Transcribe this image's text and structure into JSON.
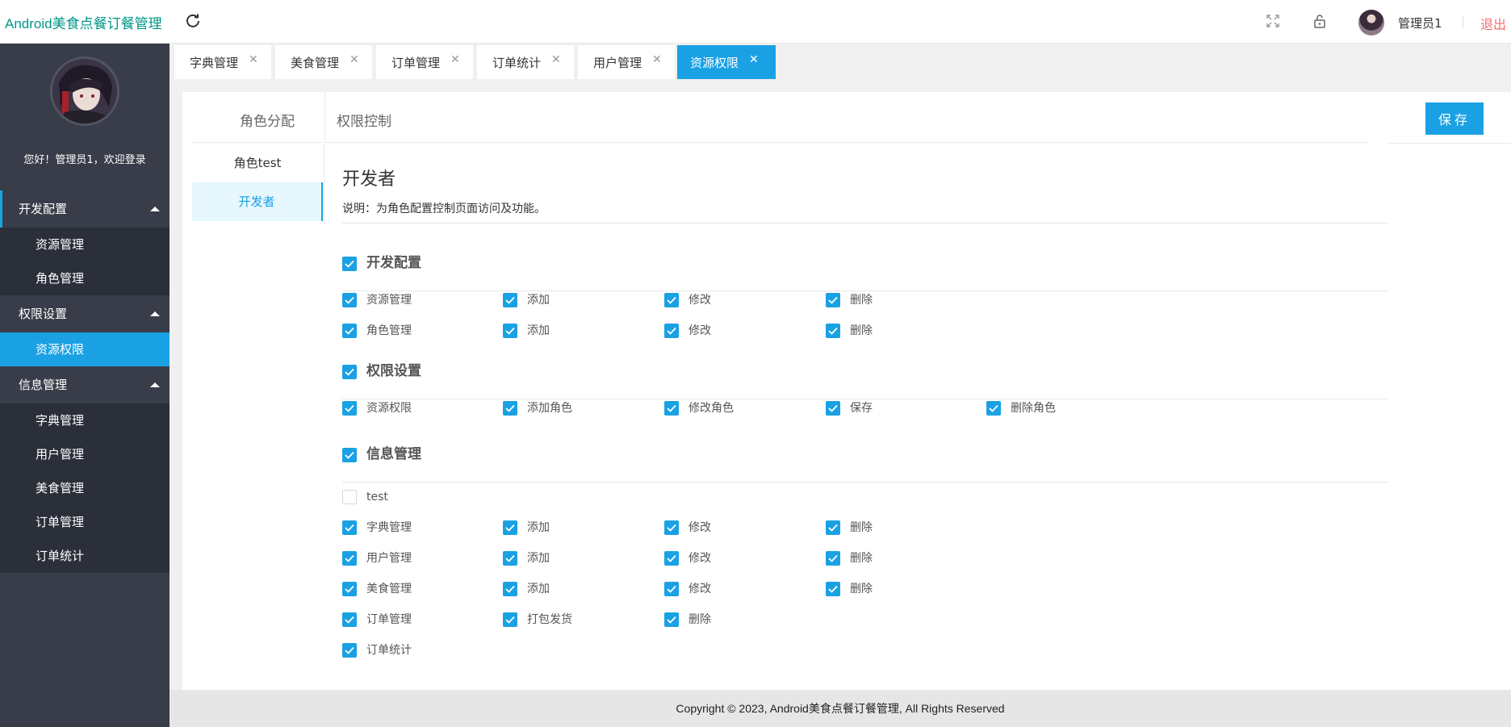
{
  "header": {
    "app_title": "Android美食点餐订餐管理",
    "user_name": "管理员1",
    "logout": "退出"
  },
  "sidebar": {
    "welcome": "您好！管理员1，欢迎登录",
    "groups": [
      {
        "label": "开发配置",
        "items": [
          "资源管理",
          "角色管理"
        ]
      },
      {
        "label": "权限设置",
        "items": [
          "资源权限"
        ]
      },
      {
        "label": "信息管理",
        "items": [
          "字典管理",
          "用户管理",
          "美食管理",
          "订单管理",
          "订单统计"
        ]
      }
    ]
  },
  "tabs": [
    {
      "label": "字典管理",
      "close": "✕"
    },
    {
      "label": "美食管理",
      "close": "✕"
    },
    {
      "label": "订单管理",
      "close": "✕"
    },
    {
      "label": "订单统计",
      "close": "✕"
    },
    {
      "label": "用户管理",
      "close": "✕"
    },
    {
      "label": "资源权限",
      "close": "✕"
    }
  ],
  "panel": {
    "role_alloc_label": "角色分配",
    "perm_ctrl_label": "权限控制",
    "save_label": "保存",
    "roles": [
      "角色test",
      "开发者"
    ],
    "selected_role_title": "开发者",
    "description": "说明：为角色配置控制页面访问及功能。"
  },
  "permissions": {
    "dev": {
      "label": "开发配置",
      "rows": [
        [
          "资源管理",
          "添加",
          "修改",
          "删除"
        ],
        [
          "角色管理",
          "添加",
          "修改",
          "删除"
        ]
      ]
    },
    "auth": {
      "label": "权限设置",
      "rows": [
        [
          "资源权限",
          "添加角色",
          "修改角色",
          "保存",
          "删除角色"
        ]
      ]
    },
    "info": {
      "label": "信息管理",
      "unchecked_item": "test",
      "rows": [
        [
          "字典管理",
          "添加",
          "修改",
          "删除"
        ],
        [
          "用户管理",
          "添加",
          "修改",
          "删除"
        ],
        [
          "美食管理",
          "添加",
          "修改",
          "删除"
        ],
        [
          "订单管理",
          "打包发货",
          "删除"
        ],
        [
          "订单统计"
        ]
      ]
    }
  },
  "footer": "Copyright © 2023, Android美食点餐订餐管理, All Rights Reserved",
  "colors": {
    "accent": "#1aa1e4",
    "sidebar": "#393d49",
    "title": "#009688",
    "logout": "#f56c6c"
  }
}
